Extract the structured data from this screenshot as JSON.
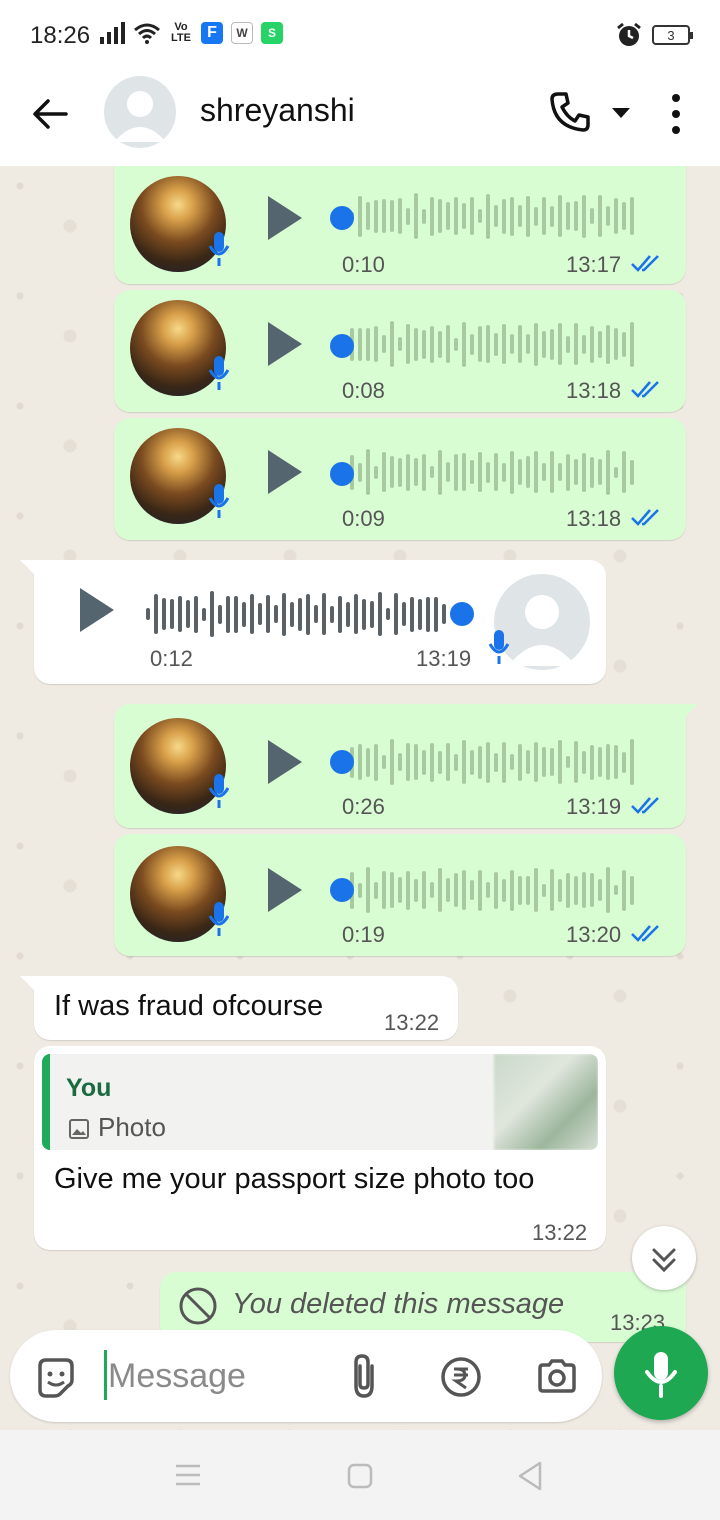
{
  "status_bar": {
    "time": "18:26",
    "volte": "Vo LTE",
    "battery": "3",
    "apps": [
      "F",
      "W",
      "S"
    ]
  },
  "header": {
    "contact_name": "shreyanshi"
  },
  "messages": [
    {
      "type": "voice",
      "direction": "outgoing",
      "duration": "0:10",
      "time": "13:17",
      "read": true
    },
    {
      "type": "voice",
      "direction": "outgoing",
      "duration": "0:08",
      "time": "13:18",
      "read": true
    },
    {
      "type": "voice",
      "direction": "outgoing",
      "duration": "0:09",
      "time": "13:18",
      "read": true
    },
    {
      "type": "voice",
      "direction": "incoming",
      "duration": "0:12",
      "time": "13:19"
    },
    {
      "type": "voice",
      "direction": "outgoing",
      "duration": "0:26",
      "time": "13:19",
      "read": true
    },
    {
      "type": "voice",
      "direction": "outgoing",
      "duration": "0:19",
      "time": "13:20",
      "read": true
    },
    {
      "type": "text",
      "direction": "incoming",
      "text": "If was fraud ofcourse",
      "time": "13:22"
    },
    {
      "type": "reply",
      "direction": "incoming",
      "quote_author": "You",
      "quote_type": "Photo",
      "text": "Give me your passport size  photo too",
      "time": "13:22"
    },
    {
      "type": "deleted",
      "direction": "outgoing",
      "text": "You deleted this message",
      "time": "13:23"
    }
  ],
  "composer": {
    "placeholder": "Message"
  },
  "colors": {
    "outgoing_bubble": "#d9fdd3",
    "incoming_bubble": "#ffffff",
    "accent_green": "#1da851",
    "read_ticks": "#1a73e8"
  }
}
